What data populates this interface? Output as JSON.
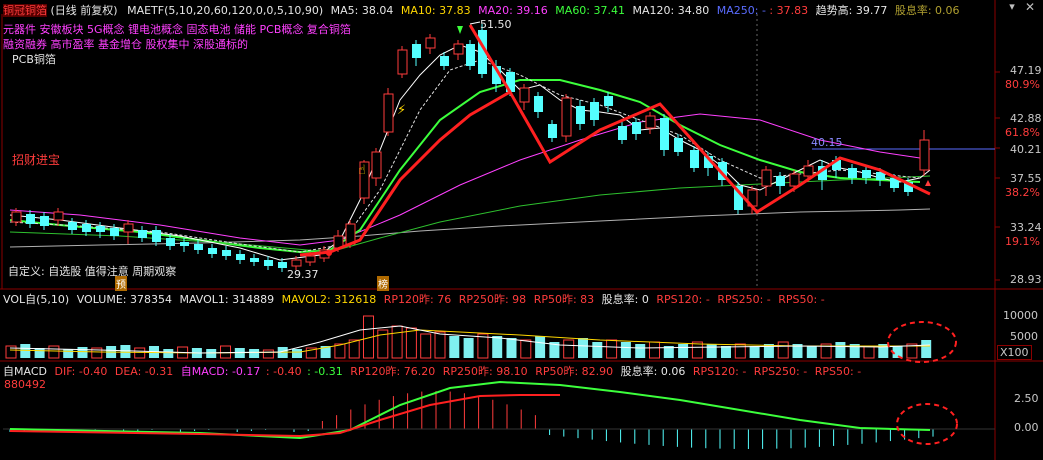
{
  "header": {
    "title": "铜冠铜箔",
    "mode": "(日线 前复权)",
    "ma_label": "MAETF(5,10,20,60,120,0,0,5,10,90)",
    "ma5": "MA5: 38.04",
    "ma10": "MA10: 37.83",
    "ma20": "MA20: 39.16",
    "ma60": "MA60: 37.41",
    "ma120": "MA120: 34.80",
    "ma250": "MA250: - ",
    "ma250_val": ": 37.83",
    "trend": "趋势高: 39.77",
    "sxl": "股息率: 0.06"
  },
  "concepts": {
    "line1": "元器件 安徽板块 5G概念 锂电池概念 固态电池 储能 PCB概念 复合铜箔",
    "line2": "融资融券 高市盈率 基金增仓 股权集中 深股通标的",
    "line3": "PCB铜箔"
  },
  "annotations": {
    "zhaocai": "招财进宝",
    "custom": "自定义: 自选股 值得注意 周期观察",
    "high": "51.50",
    "low": "29.37",
    "mid": "40.15",
    "bang": "榜",
    "yu": "预"
  },
  "price_axis": {
    "ticks": [
      "47.19",
      "80.9%",
      "42.88",
      "61.8%",
      "40.21",
      "37.55",
      "38.2%",
      "33.24",
      "19.1%",
      "28.93"
    ]
  },
  "volume": {
    "label": "VOL自(5,10)",
    "volume": "VOLUME: 378354",
    "mavol1": "MAVOL1: 314889",
    "mavol2": "MAVOL2: 312618",
    "rp120": "RP120昨: 76",
    "rp250": "RP250昨: 98",
    "rp50": "RP50昨: 83",
    "gxl": "股息率: 0",
    "rps120": "RPS120: -",
    "rps250": "RPS250: -",
    "rps50": "RPS50: -",
    "ticks": [
      "10000",
      "5000"
    ],
    "unit": "X100"
  },
  "macd": {
    "label": "自MACD",
    "dif": "DIF: -0.40",
    "dea": "DEA: -0.31",
    "macd": "自MACD: -0.17",
    "extra1": ": -0.40",
    "extra2": ": -0.31",
    "rp120": "RP120昨: 76.20",
    "rp250": "RP250昨: 98.10",
    "rp50": "RP50昨: 82.90",
    "gxl": "股息率: 0.06",
    "rps120": "RPS120: -",
    "rps250": "RPS250: -",
    "rps50": "RPS50: -",
    "code": "880492",
    "ticks": [
      "2.50",
      "0.00"
    ]
  },
  "colors": {
    "up": "#ff3c3c",
    "down": "#54ffff",
    "ma5": "#ffffff",
    "ma20": "#3cff3c",
    "ma60": "#ff40ff",
    "trend": "#ff2020",
    "volume_bar": "#7ff0f0"
  }
}
